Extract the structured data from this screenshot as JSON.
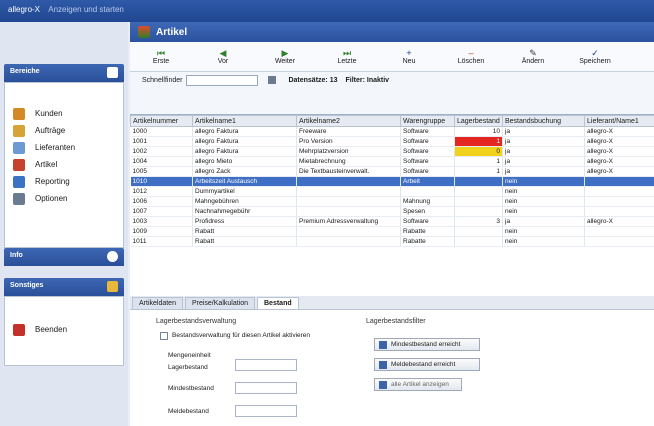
{
  "titlebar": {
    "app": "allegro-X",
    "subtitle": "Anzeigen und starten"
  },
  "sidebar": {
    "bereiche_title": "Bereiche",
    "items": [
      {
        "label": "Kunden",
        "icon": "people-icon",
        "color": "#d38a26"
      },
      {
        "label": "Aufträge",
        "icon": "order-icon",
        "color": "#d6a337"
      },
      {
        "label": "Lieferanten",
        "icon": "truck-icon",
        "color": "#6e9ad3"
      },
      {
        "label": "Artikel",
        "icon": "box-icon",
        "color": "#c7412f"
      },
      {
        "label": "Reporting",
        "icon": "report-icon",
        "color": "#3a72c4"
      },
      {
        "label": "Optionen",
        "icon": "options-icon",
        "color": "#6a7a90"
      }
    ],
    "info_title": "Info",
    "sonstiges_title": "Sonstiges",
    "beenden_label": "Beenden"
  },
  "main": {
    "title": "Artikel",
    "toolbar": [
      {
        "label": "Erste",
        "glyph": "⏮"
      },
      {
        "label": "Vor",
        "glyph": "◀"
      },
      {
        "label": "Weiter",
        "glyph": "▶"
      },
      {
        "label": "Letzte",
        "glyph": "⏭"
      },
      {
        "label": "Neu",
        "glyph": "+"
      },
      {
        "label": "Löschen",
        "glyph": "–"
      },
      {
        "label": "Ändern",
        "glyph": "✎"
      },
      {
        "label": "Speichern",
        "glyph": "✓"
      }
    ],
    "filter": {
      "label": "Schnellfinder",
      "records": "Datensätze: 13",
      "filter": "Filter: Inaktiv"
    },
    "columns": [
      "Artikelnummer",
      "Artikelname1",
      "Artikelname2",
      "Warengruppe",
      "Lagerbestand",
      "Bestandsbuchung",
      "Lieferant/Name1"
    ],
    "rows": [
      [
        "1000",
        "allegro Faktura",
        "Freeware",
        "Software",
        "10",
        "ja",
        "allegro-X"
      ],
      [
        "1001",
        "allegro Faktura",
        "Pro Version",
        "Software",
        "1",
        "ja",
        "allegro-X"
      ],
      [
        "1002",
        "allegro Faktura",
        "Mehrplatzversion",
        "Software",
        "0",
        "ja",
        "allegro-X"
      ],
      [
        "1004",
        "allegro Mieto",
        "Mietabrechnung",
        "Software",
        "1",
        "ja",
        "allegro-X"
      ],
      [
        "1005",
        "allegro Zack",
        "Die Textbausteinverwalt.",
        "Software",
        "1",
        "ja",
        "allegro-X"
      ],
      [
        "1010",
        "Arbeitszeit Austausch",
        "",
        "Arbeit",
        "",
        "nein",
        ""
      ],
      [
        "1012",
        "Dummyartikel",
        "",
        "",
        "",
        "nein",
        ""
      ],
      [
        "1006",
        "Mahngebühren",
        "",
        "Mahnung",
        "",
        "nein",
        ""
      ],
      [
        "1007",
        "Nachnahmegebühr",
        "",
        "Spesen",
        "",
        "nein",
        ""
      ],
      [
        "1003",
        "Profidress",
        "Premium Adressverwaltung",
        "Software",
        "3",
        "ja",
        "allegro-X"
      ],
      [
        "1009",
        "Rabatt",
        "",
        "Rabatte",
        "",
        "nein",
        ""
      ],
      [
        "1011",
        "Rabatt",
        "",
        "Rabatte",
        "",
        "nein",
        ""
      ]
    ],
    "selected_row": 5,
    "tabs": [
      "Artikeldaten",
      "Preise/Kalkulation",
      "Bestand"
    ],
    "detail": {
      "left_section": "Lagerbestandsverwaltung",
      "checkbox": "Bestandsverwaltung für diesen Artikel aktivieren",
      "fields": [
        "Mengeneinheit",
        "Lagerbestand",
        "Mindestbestand",
        "Meldebestand"
      ],
      "right_section": "Lagerbestandsfilter",
      "buttons": [
        "Mindestbestand erreicht",
        "Meldebestand erreicht",
        "alle Artikel anzeigen"
      ]
    }
  }
}
